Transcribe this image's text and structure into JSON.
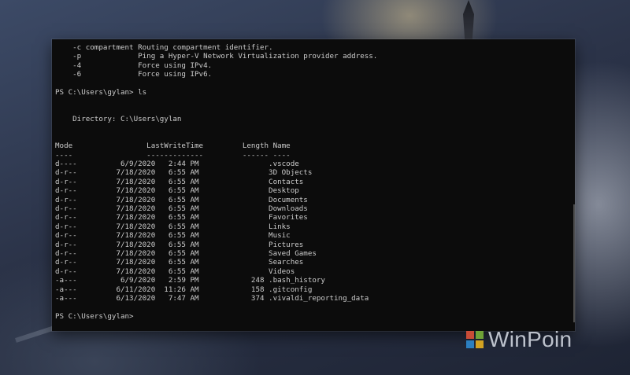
{
  "terminal": {
    "lines": [
      "    -c compartment Routing compartment identifier.",
      "    -p             Ping a Hyper-V Network Virtualization provider address.",
      "    -4             Force using IPv4.",
      "    -6             Force using IPv6.",
      "",
      "PS C:\\Users\\gylan> ls",
      "",
      "",
      "    Directory: C:\\Users\\gylan",
      "",
      "",
      "Mode                 LastWriteTime         Length Name",
      "----                 -------------         ------ ----",
      "d----          6/9/2020   2:44 PM                .vscode",
      "d-r--         7/18/2020   6:55 AM                3D Objects",
      "d-r--         7/18/2020   6:55 AM                Contacts",
      "d-r--         7/18/2020   6:55 AM                Desktop",
      "d-r--         7/18/2020   6:55 AM                Documents",
      "d-r--         7/18/2020   6:55 AM                Downloads",
      "d-r--         7/18/2020   6:55 AM                Favorites",
      "d-r--         7/18/2020   6:55 AM                Links",
      "d-r--         7/18/2020   6:55 AM                Music",
      "d-r--         7/18/2020   6:55 AM                Pictures",
      "d-r--         7/18/2020   6:55 AM                Saved Games",
      "d-r--         7/18/2020   6:55 AM                Searches",
      "d-r--         7/18/2020   6:55 AM                Videos",
      "-a---          6/9/2020   2:59 PM            248 .bash_history",
      "-a---         6/11/2020  11:26 AM            158 .gitconfig",
      "-a---         6/13/2020   7:47 AM            374 .vivaldi_reporting_data",
      "",
      "PS C:\\Users\\gylan>"
    ]
  },
  "watermark": {
    "text": "WinPoin",
    "logo_colors": [
      "#e8553a",
      "#7fba3a",
      "#2f8fd8",
      "#f2b81e"
    ]
  },
  "icons": {
    "watermark_logo": "windows-logo-icon"
  }
}
